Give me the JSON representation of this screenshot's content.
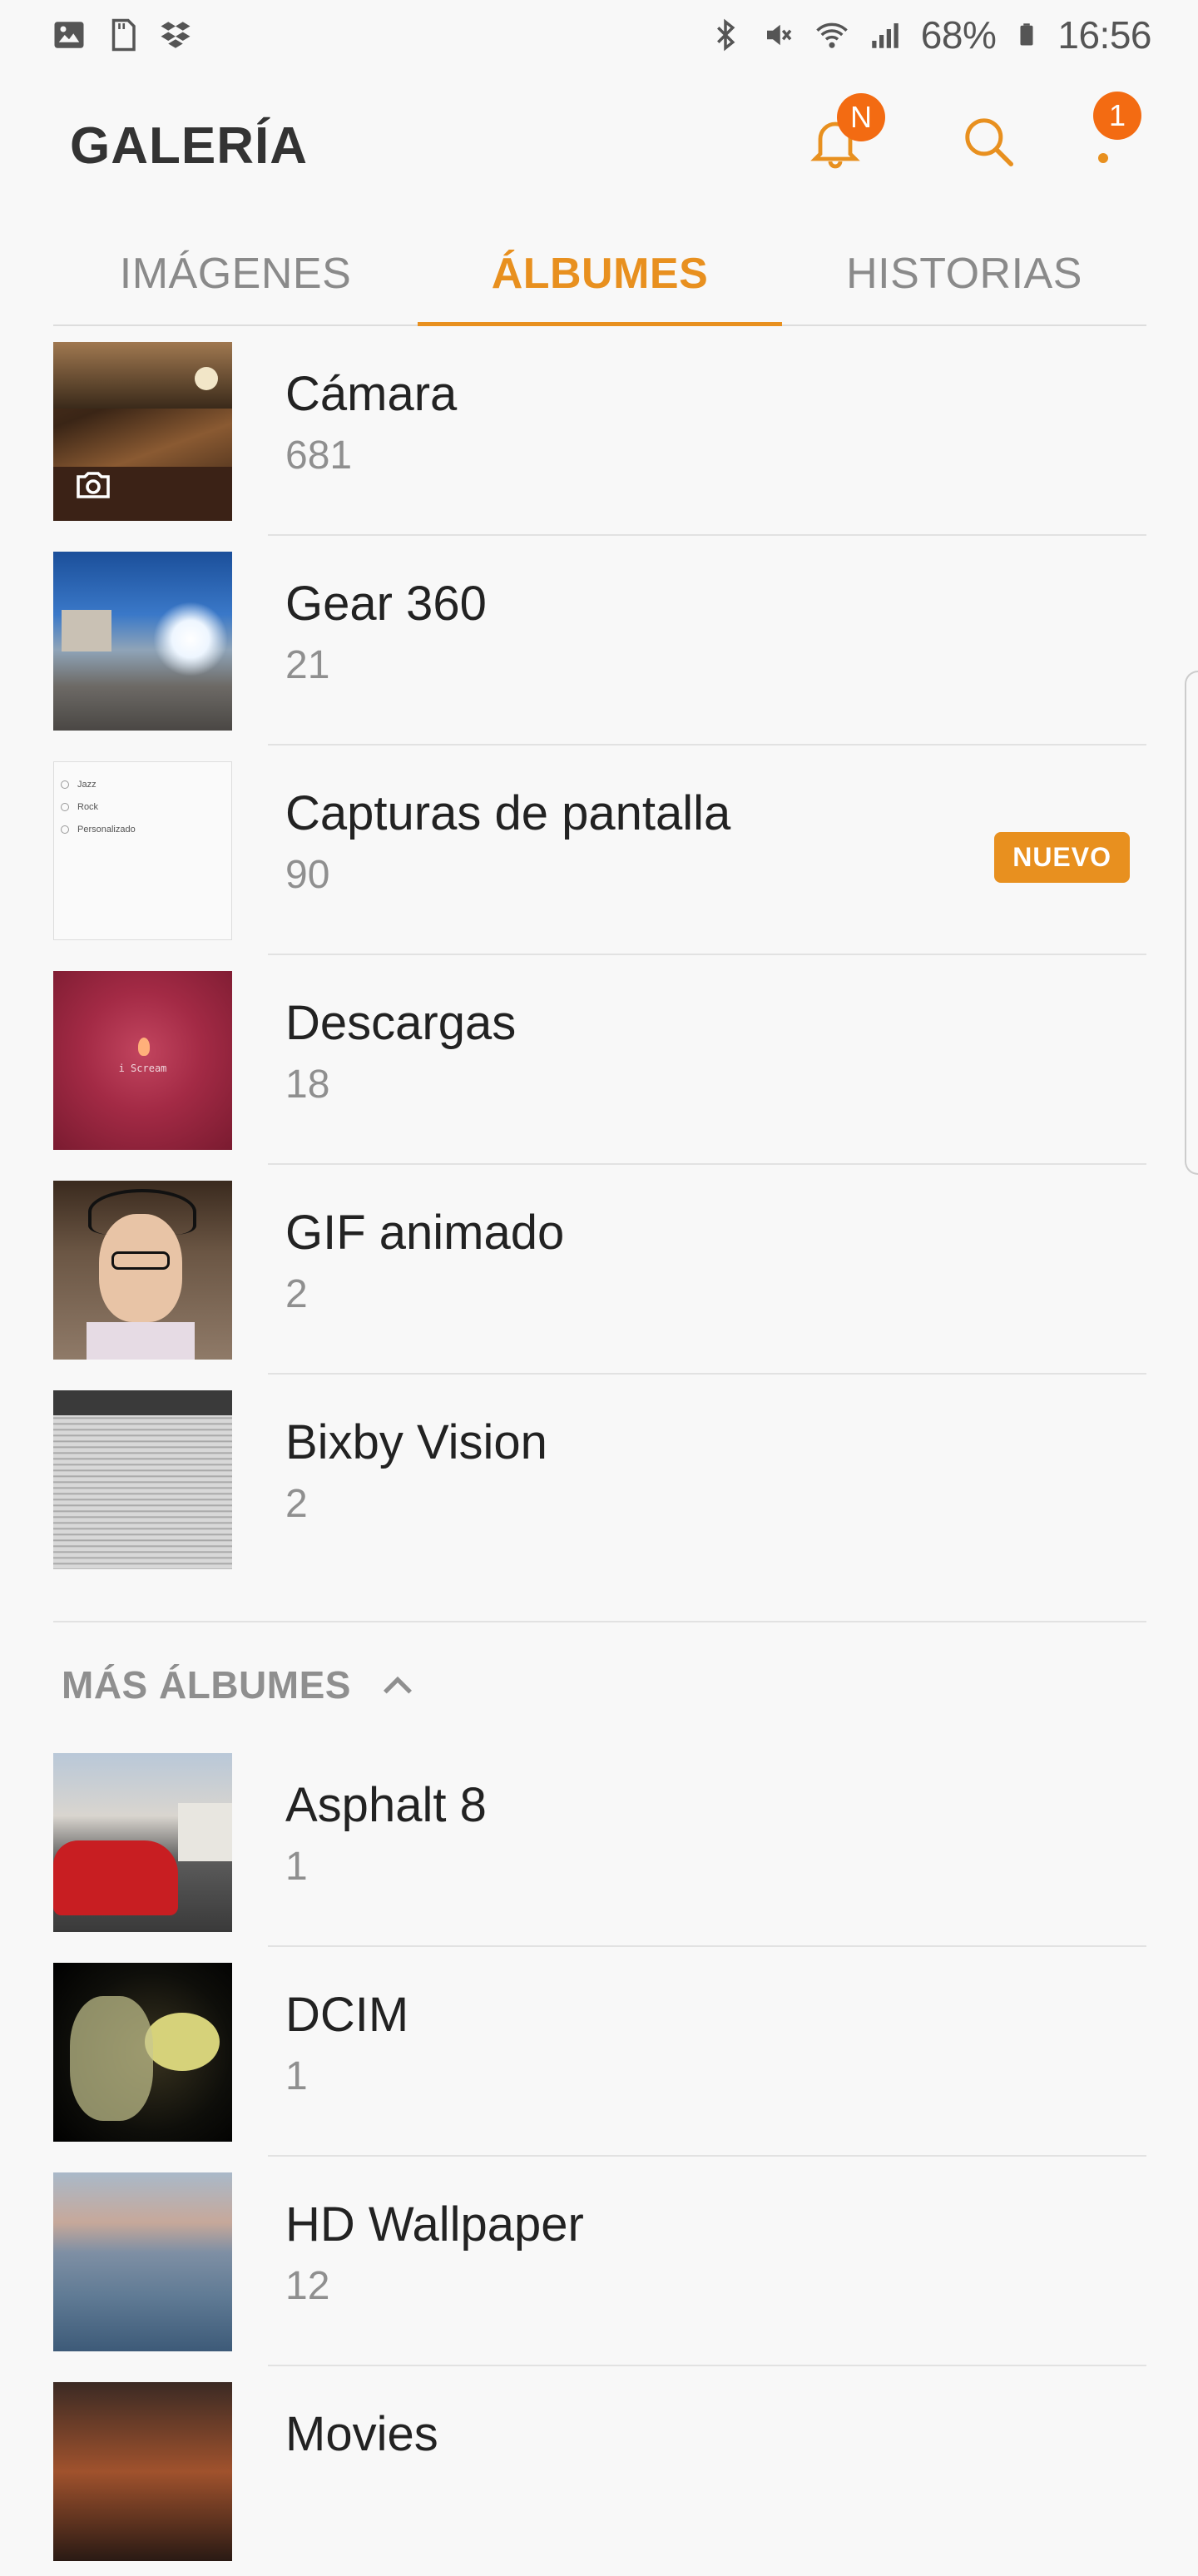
{
  "status_bar": {
    "battery": "68%",
    "time": "16:56",
    "left_icons": [
      "gallery-icon",
      "sd-card-icon",
      "dropbox-icon"
    ],
    "right_icons": [
      "bluetooth-icon",
      "mute-icon",
      "wifi-icon",
      "signal-icon",
      "battery-icon"
    ]
  },
  "header": {
    "title": "GALERÍA",
    "notification_badge": "N",
    "more_badge": "1"
  },
  "tabs": [
    {
      "label": "IMÁGENES",
      "active": false
    },
    {
      "label": "ÁLBUMES",
      "active": true
    },
    {
      "label": "HISTORIAS",
      "active": false
    }
  ],
  "albums": [
    {
      "name": "Cámara",
      "count": "681"
    },
    {
      "name": "Gear 360",
      "count": "21"
    },
    {
      "name": "Capturas de pantalla",
      "count": "90",
      "badge": "NUEVO"
    },
    {
      "name": "Descargas",
      "count": "18"
    },
    {
      "name": "GIF animado",
      "count": "2"
    },
    {
      "name": "Bixby Vision",
      "count": "2"
    }
  ],
  "more_albums": {
    "label": "MÁS ÁLBUMES",
    "items": [
      {
        "name": "Asphalt 8",
        "count": "1"
      },
      {
        "name": "DCIM",
        "count": "1"
      },
      {
        "name": "HD Wallpaper",
        "count": "12"
      },
      {
        "name": "Movies",
        "count": ""
      }
    ]
  },
  "thumbnail_texts": {
    "capture_options": [
      "Jazz",
      "Rock",
      "Personalizado"
    ],
    "descargas_caption": "i Scream"
  },
  "colors": {
    "accent": "#e8901f",
    "badge": "#f36b12",
    "background": "#f8f8f8"
  }
}
